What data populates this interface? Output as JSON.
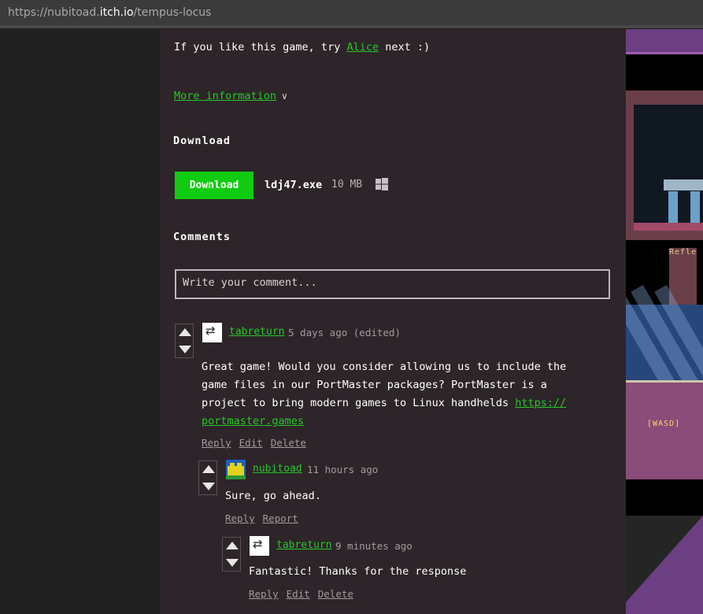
{
  "browser": {
    "url_prefix": "https://nubitoad.",
    "url_host": "itch.io",
    "url_path": "/tempus-locus"
  },
  "intro": {
    "text_before": "If you like this game, try",
    "link": "Alice",
    "text_after": "next :)"
  },
  "more_info": "More information",
  "download": {
    "heading": "Download",
    "button": "Download",
    "file_name": "ldj47.exe",
    "file_size": "10 MB",
    "platform_icon": "windows-icon"
  },
  "comments": {
    "heading": "Comments",
    "placeholder": "Write your comment...",
    "items": [
      {
        "user": "tabreturn",
        "time": "5 days ago (edited)",
        "body_line1": "Great game! Would you consider allowing us to include the",
        "body_line2": "game files in our PortMaster packages? PortMaster is a",
        "body_line3_text": "project to bring modern games to Linux handhelds",
        "body_link_part1": "https://",
        "body_link_part2": "portmaster.games",
        "actions": [
          "Reply",
          "Edit",
          "Delete"
        ]
      },
      {
        "user": "nubitoad",
        "time": "11 hours ago",
        "body": "Sure, go ahead.",
        "actions": [
          "Reply",
          "Report"
        ]
      },
      {
        "user": "tabreturn",
        "time": "9 minutes ago",
        "body": "Fantastic! Thanks for the response",
        "actions": [
          "Reply",
          "Edit",
          "Delete"
        ]
      }
    ]
  },
  "sidebar_shots": {
    "label_1": "Refle",
    "label_2": "[WASD]"
  },
  "colors": {
    "link": "#27c627",
    "download_button": "#10cc10",
    "page_bg": "#2d2529"
  }
}
